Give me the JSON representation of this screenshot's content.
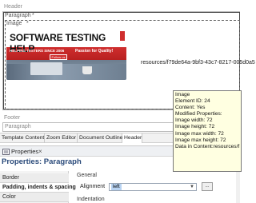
{
  "editor": {
    "header_label": "Header",
    "paragraph_label": "Paragraph",
    "image_label": "Image",
    "required_marker": "*",
    "resource_path": "resources/f79de64a-9bf3-43c7-8217-005d0a5",
    "footer_label": "Footer",
    "footer_paragraph_label": "Paragraph"
  },
  "banner": {
    "title": "SOFTWARE TESTING HELP",
    "badge": "!",
    "tagline": "HELPING TESTERS SINCE 2006",
    "subtitle": "Passion for Quality!",
    "follow": "Follow us"
  },
  "tooltip": {
    "lines": [
      "Image",
      "Element ID: 24",
      "Content: Yes",
      "Modified Properties:",
      " Image width: 72",
      " Image height: 72",
      " Image max width: 72",
      " Image max height: 72",
      "Data in Content:resources/f"
    ]
  },
  "editor_tabs": [
    {
      "label": "Template Content",
      "active": false
    },
    {
      "label": "Zoom Editor",
      "active": false
    },
    {
      "label": "Document Outline",
      "active": false
    },
    {
      "label": "Header",
      "active": true
    }
  ],
  "properties": {
    "view_tab": "Properties",
    "close_symbol": "×",
    "title": "Properties: Paragraph",
    "nav": [
      {
        "label": "Border",
        "active": false
      },
      {
        "label": "Padding, indents & spacing",
        "active": true
      },
      {
        "label": "Color",
        "active": false
      }
    ],
    "general_label": "General",
    "alignment_label": "Alignment",
    "alignment_value": "left",
    "more_button": "...",
    "indentation_label": "Indentation"
  }
}
